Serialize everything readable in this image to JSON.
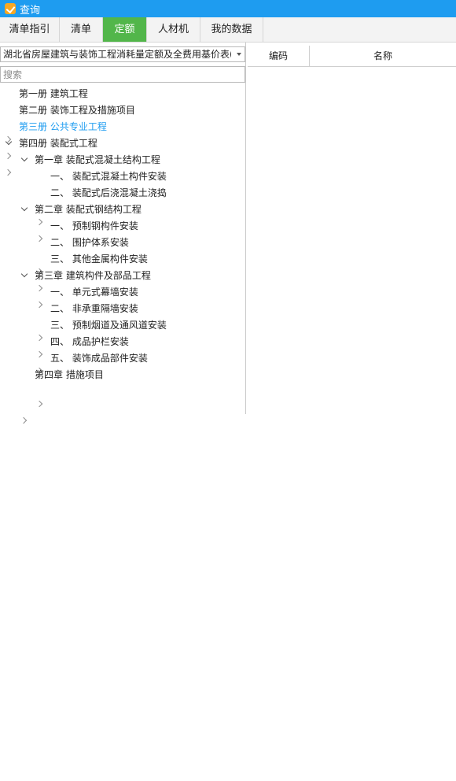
{
  "window": {
    "title": "查询"
  },
  "tabs": [
    "清单指引",
    "清单",
    "定额",
    "人材机",
    "我的数据"
  ],
  "dropdown": {
    "value": "湖北省房屋建筑与装饰工程消耗量定额及全费用基价表("
  },
  "search": {
    "placeholder": "搜索"
  },
  "tree": [
    {
      "label": "第一册 建筑工程"
    },
    {
      "label": "第二册 装饰工程及措施项目"
    },
    {
      "label": "第三册 公共专业工程"
    },
    {
      "label": "第四册 装配式工程"
    },
    {
      "label": "第一章 装配式混凝土结构工程"
    },
    {
      "label": "一、 装配式混凝土构件安装"
    },
    {
      "label": "二、 装配式后浇混凝土浇捣"
    },
    {
      "label": "第二章 装配式钢结构工程"
    },
    {
      "label": "一、 预制钢构件安装"
    },
    {
      "label": "二、 围护体系安装"
    },
    {
      "label": "三、 其他金属构件安装"
    },
    {
      "label": "第三章 建筑构件及部品工程"
    },
    {
      "label": "一、 单元式幕墙安装"
    },
    {
      "label": "二、 非承重隔墙安装"
    },
    {
      "label": "三、 预制烟道及通风道安装"
    },
    {
      "label": "四、 成品护栏安装"
    },
    {
      "label": "五、 装饰成品部件安装"
    },
    {
      "label": "第四章 措施项目"
    }
  ],
  "table": {
    "columns": [
      "编码",
      "名称"
    ]
  },
  "colors": {
    "titlebar": "#1e9cf0",
    "active_tab": "#52b64a",
    "highlight": "#1e9cf0"
  },
  "icons": {
    "app": "app-logo-icon",
    "dropdown": "chevron-down-icon",
    "collapsed": "chevron-right-icon",
    "expanded": "chevron-down-icon"
  }
}
